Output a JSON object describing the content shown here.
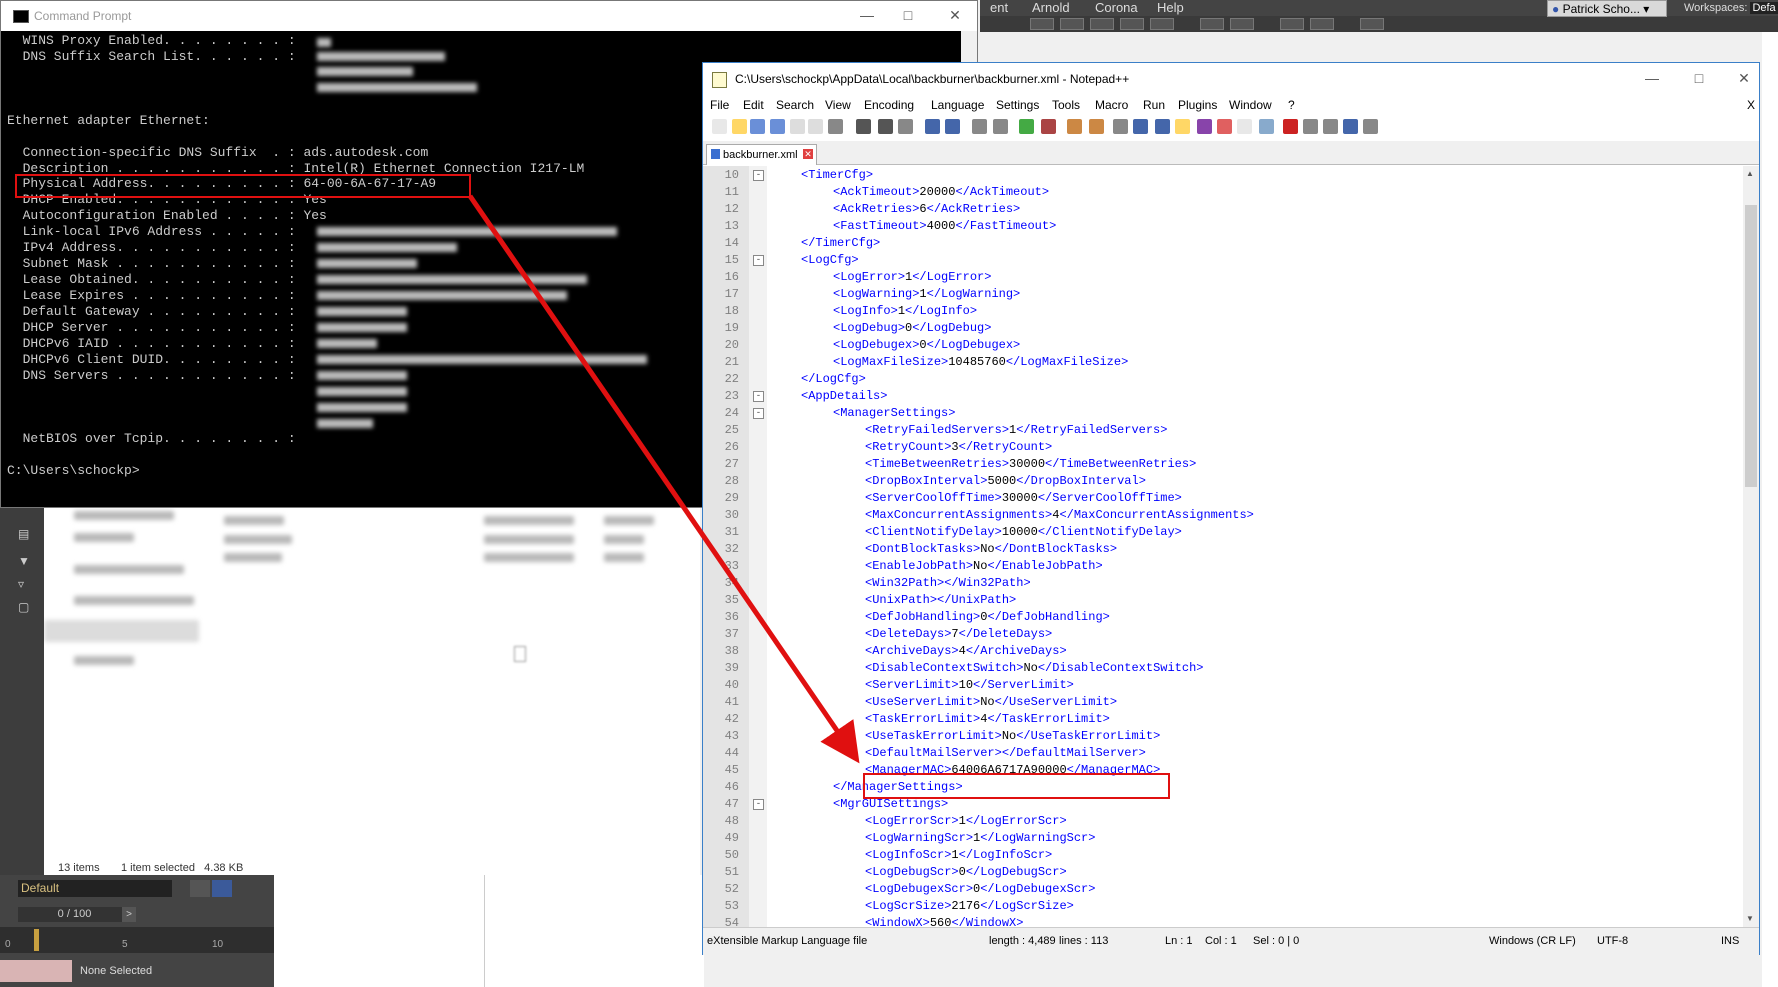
{
  "background_app": {
    "menu": [
      "ent",
      "Arnold",
      "Corona",
      "Help"
    ],
    "user": "Patrick Scho...",
    "workspaces_label": "Workspaces:",
    "workspaces_value": "Defa",
    "layer": "Default",
    "frame": "0 / 100",
    "timeline_ticks": [
      "0",
      "5",
      "10"
    ],
    "selection": "None Selected"
  },
  "explorer": {
    "items_count": "13 items",
    "selected": "1 item selected",
    "size": "4.38 KB"
  },
  "cmd": {
    "title": "Command Prompt",
    "lines": [
      "  WINS Proxy Enabled. . . . . . . . :",
      "  DNS Suffix Search List. . . . . . :",
      "",
      "",
      "",
      "Ethernet adapter Ethernet:",
      "",
      "  Connection-specific DNS Suffix  . : ads.autodesk.com",
      "  Description . . . . . . . . . . . : Intel(R) Ethernet Connection I217-LM",
      "  Physical Address. . . . . . . . . : 64-00-6A-67-17-A9",
      "  DHCP Enabled. . . . . . . . . . . : Yes",
      "  Autoconfiguration Enabled . . . . : Yes",
      "  Link-local IPv6 Address . . . . . :",
      "  IPv4 Address. . . . . . . . . . . :",
      "  Subnet Mask . . . . . . . . . . . :",
      "  Lease Obtained. . . . . . . . . . :",
      "  Lease Expires . . . . . . . . . . :",
      "  Default Gateway . . . . . . . . . :",
      "  DHCP Server . . . . . . . . . . . :",
      "  DHCPv6 IAID . . . . . . . . . . . :",
      "  DHCPv6 Client DUID. . . . . . . . :",
      "  DNS Servers . . . . . . . . . . . :",
      "",
      "",
      "",
      "  NetBIOS over Tcpip. . . . . . . . :",
      "",
      "C:\\Users\\schockp>"
    ]
  },
  "npp": {
    "title": "C:\\Users\\schockp\\AppData\\Local\\backburner\\backburner.xml - Notepad++",
    "menu": [
      "File",
      "Edit",
      "Search",
      "View",
      "Encoding",
      "Language",
      "Settings",
      "Tools",
      "Macro",
      "Run",
      "Plugins",
      "Window",
      "?"
    ],
    "close_doc": "X",
    "tab": "backburner.xml",
    "lines": [
      {
        "n": "10",
        "indent": 1,
        "tag": "TimerCfg",
        "kind": "open"
      },
      {
        "n": "11",
        "indent": 2,
        "tag": "AckTimeout",
        "value": "20000"
      },
      {
        "n": "12",
        "indent": 2,
        "tag": "AckRetries",
        "value": "6"
      },
      {
        "n": "13",
        "indent": 2,
        "tag": "FastTimeout",
        "value": "4000"
      },
      {
        "n": "14",
        "indent": 1,
        "tag": "TimerCfg",
        "kind": "close"
      },
      {
        "n": "15",
        "indent": 1,
        "tag": "LogCfg",
        "kind": "open"
      },
      {
        "n": "16",
        "indent": 2,
        "tag": "LogError",
        "value": "1"
      },
      {
        "n": "17",
        "indent": 2,
        "tag": "LogWarning",
        "value": "1"
      },
      {
        "n": "18",
        "indent": 2,
        "tag": "LogInfo",
        "value": "1"
      },
      {
        "n": "19",
        "indent": 2,
        "tag": "LogDebug",
        "value": "0"
      },
      {
        "n": "20",
        "indent": 2,
        "tag": "LogDebugex",
        "value": "0"
      },
      {
        "n": "21",
        "indent": 2,
        "tag": "LogMaxFileSize",
        "value": "10485760"
      },
      {
        "n": "22",
        "indent": 1,
        "tag": "LogCfg",
        "kind": "close"
      },
      {
        "n": "23",
        "indent": 1,
        "tag": "AppDetails",
        "kind": "open"
      },
      {
        "n": "24",
        "indent": 2,
        "tag": "ManagerSettings",
        "kind": "open"
      },
      {
        "n": "25",
        "indent": 3,
        "tag": "RetryFailedServers",
        "value": "1"
      },
      {
        "n": "26",
        "indent": 3,
        "tag": "RetryCount",
        "value": "3"
      },
      {
        "n": "27",
        "indent": 3,
        "tag": "TimeBetweenRetries",
        "value": "30000"
      },
      {
        "n": "28",
        "indent": 3,
        "tag": "DropBoxInterval",
        "value": "5000"
      },
      {
        "n": "29",
        "indent": 3,
        "tag": "ServerCoolOffTime",
        "value": "30000"
      },
      {
        "n": "30",
        "indent": 3,
        "tag": "MaxConcurrentAssignments",
        "value": "4"
      },
      {
        "n": "31",
        "indent": 3,
        "tag": "ClientNotifyDelay",
        "value": "10000"
      },
      {
        "n": "32",
        "indent": 3,
        "tag": "DontBlockTasks",
        "value": "No"
      },
      {
        "n": "33",
        "indent": 3,
        "tag": "EnableJobPath",
        "value": "No"
      },
      {
        "n": "34",
        "indent": 3,
        "tag": "Win32Path",
        "value": ""
      },
      {
        "n": "35",
        "indent": 3,
        "tag": "UnixPath",
        "value": ""
      },
      {
        "n": "36",
        "indent": 3,
        "tag": "DefJobHandling",
        "value": "0"
      },
      {
        "n": "37",
        "indent": 3,
        "tag": "DeleteDays",
        "value": "7"
      },
      {
        "n": "38",
        "indent": 3,
        "tag": "ArchiveDays",
        "value": "4"
      },
      {
        "n": "39",
        "indent": 3,
        "tag": "DisableContextSwitch",
        "value": "No"
      },
      {
        "n": "40",
        "indent": 3,
        "tag": "ServerLimit",
        "value": "10"
      },
      {
        "n": "41",
        "indent": 3,
        "tag": "UseServerLimit",
        "value": "No"
      },
      {
        "n": "42",
        "indent": 3,
        "tag": "TaskErrorLimit",
        "value": "4"
      },
      {
        "n": "43",
        "indent": 3,
        "tag": "UseTaskErrorLimit",
        "value": "No"
      },
      {
        "n": "44",
        "indent": 3,
        "tag": "DefaultMailServer",
        "value": ""
      },
      {
        "n": "45",
        "indent": 3,
        "tag": "ManagerMAC",
        "value": "64006A6717A90000"
      },
      {
        "n": "46",
        "indent": 2,
        "tag": "ManagerSettings",
        "kind": "close"
      },
      {
        "n": "47",
        "indent": 2,
        "tag": "MgrGUISettings",
        "kind": "open"
      },
      {
        "n": "48",
        "indent": 3,
        "tag": "LogErrorScr",
        "value": "1"
      },
      {
        "n": "49",
        "indent": 3,
        "tag": "LogWarningScr",
        "value": "1"
      },
      {
        "n": "50",
        "indent": 3,
        "tag": "LogInfoScr",
        "value": "1"
      },
      {
        "n": "51",
        "indent": 3,
        "tag": "LogDebugScr",
        "value": "0"
      },
      {
        "n": "52",
        "indent": 3,
        "tag": "LogDebugexScr",
        "value": "0"
      },
      {
        "n": "53",
        "indent": 3,
        "tag": "LogScrSize",
        "value": "2176"
      },
      {
        "n": "54",
        "indent": 3,
        "tag": "WindowX",
        "value": "560"
      }
    ],
    "status": {
      "type": "eXtensible Markup Language file",
      "length": "length : 4,489",
      "lines": "lines : 113",
      "ln": "Ln : 1",
      "col": "Col : 1",
      "sel": "Sel : 0 | 0",
      "eol": "Windows (CR LF)",
      "enc": "UTF-8",
      "mode": "INS"
    }
  },
  "colors": {
    "highlight_box": "#e01010",
    "xml_tag": "#0000ff",
    "npp_border": "#3a7fc8"
  }
}
